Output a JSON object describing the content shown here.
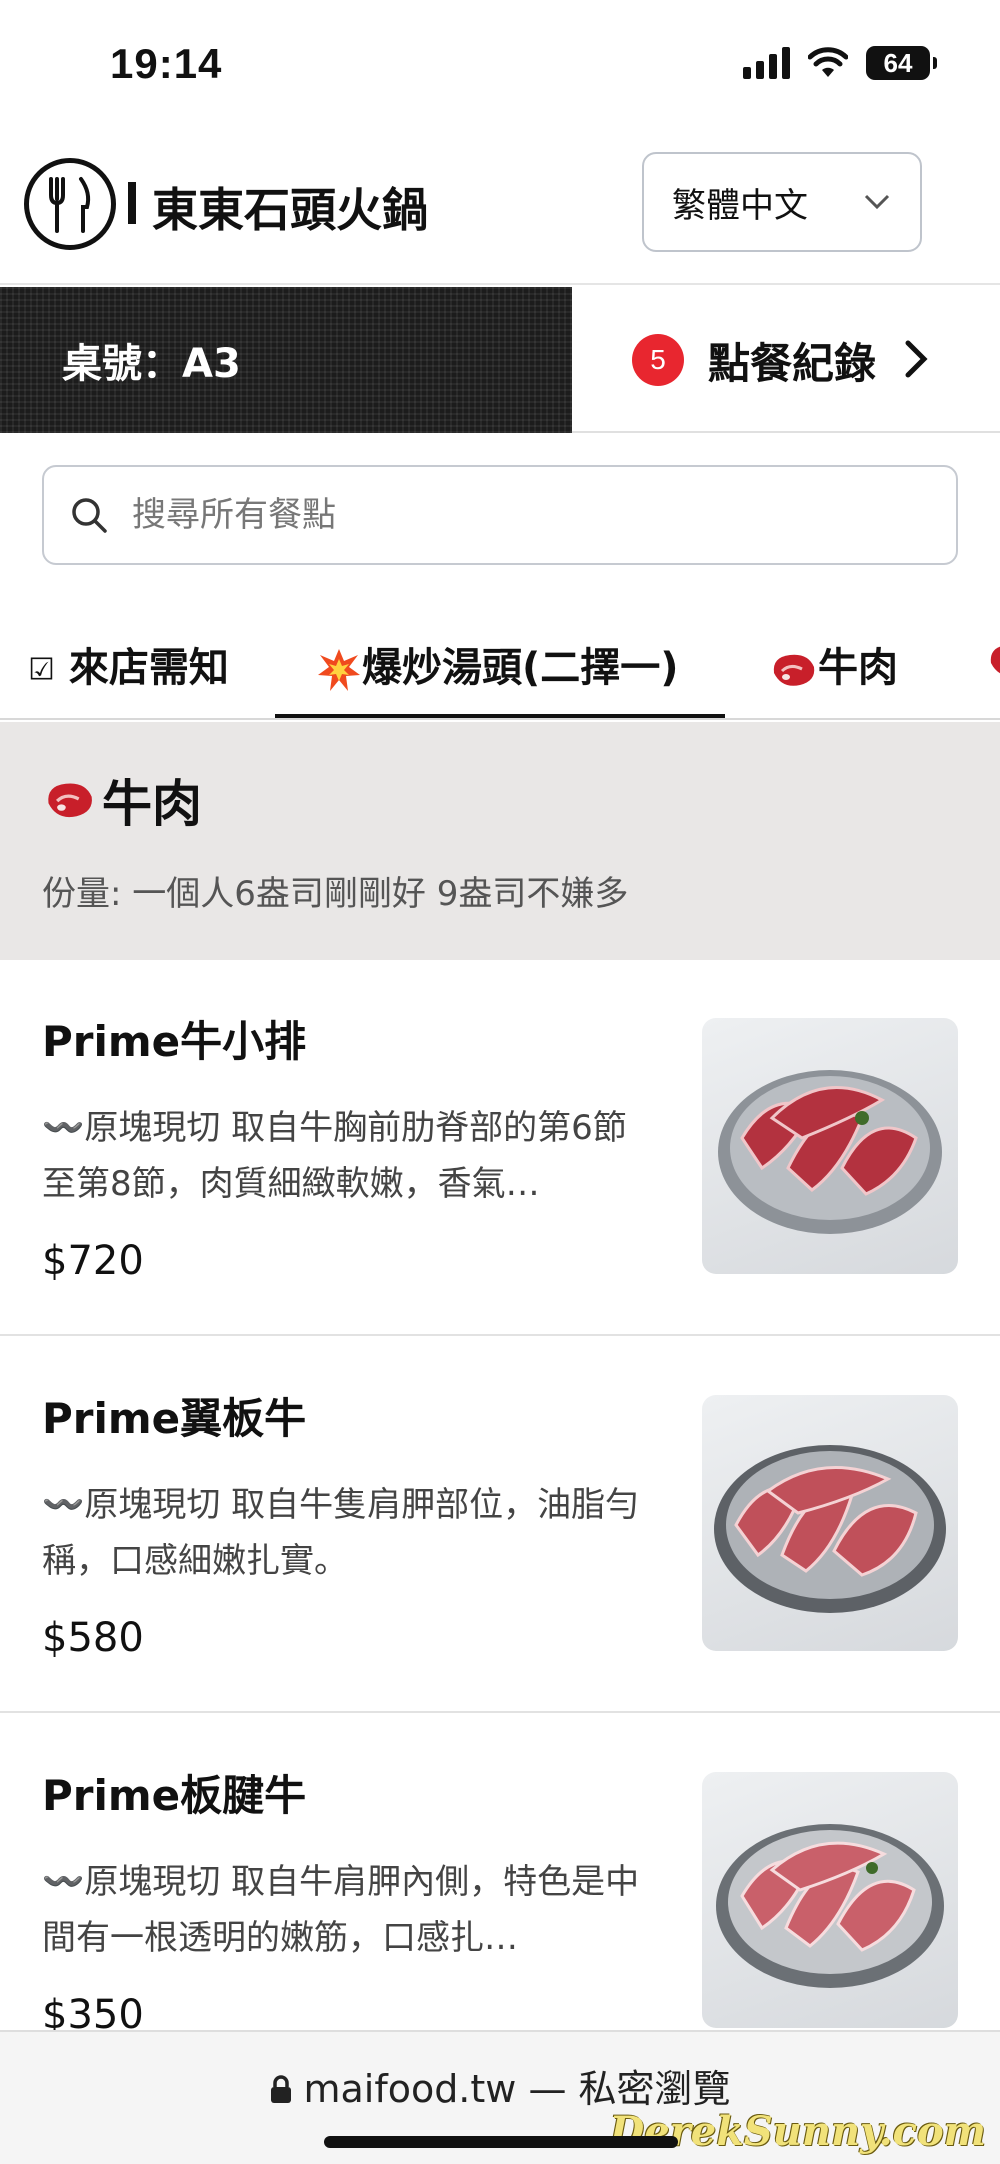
{
  "status_bar": {
    "time": "19:14",
    "battery": "64"
  },
  "header": {
    "restaurant_name": "東東石頭火鍋",
    "language": "繁體中文"
  },
  "table": {
    "label": "桌號：A3"
  },
  "orders": {
    "count": "5",
    "label": "點餐紀錄"
  },
  "search": {
    "placeholder": "搜尋所有餐點"
  },
  "tabs": [
    {
      "icon": "ballot-check-icon",
      "label": "來店需知"
    },
    {
      "icon": "explosion-icon",
      "label": "爆炒湯頭(二擇一)"
    },
    {
      "icon": "meat-icon",
      "label": "牛肉"
    }
  ],
  "active_tab": 1,
  "category": {
    "title": "牛肉",
    "description": "份量: 一個人6盎司剛剛好 9盎司不嫌多"
  },
  "items": [
    {
      "name": "Prime牛小排",
      "description": "〰️原塊現切 取自牛胸前肋脊部的第6節至第8節，肉質細緻軟嫩，香氣…",
      "price": "$720"
    },
    {
      "name": "Prime翼板牛",
      "description": "〰️原塊現切 取自牛隻肩胛部位，油脂勻稱，口感細嫩扎實。",
      "price": "$580"
    },
    {
      "name": "Prime板腱牛",
      "description": "〰️原塊現切 取自牛肩胛內側，特色是中間有一根透明的嫩筋，口感扎…",
      "price": "$350"
    }
  ],
  "browser": {
    "url": "maifood.tw — 私密瀏覽"
  },
  "watermark": "DerekSunny.com",
  "colors": {
    "badge": "#e8262f",
    "category_bg": "#e9e7e6",
    "dark_strip": "#1c1c1c"
  }
}
